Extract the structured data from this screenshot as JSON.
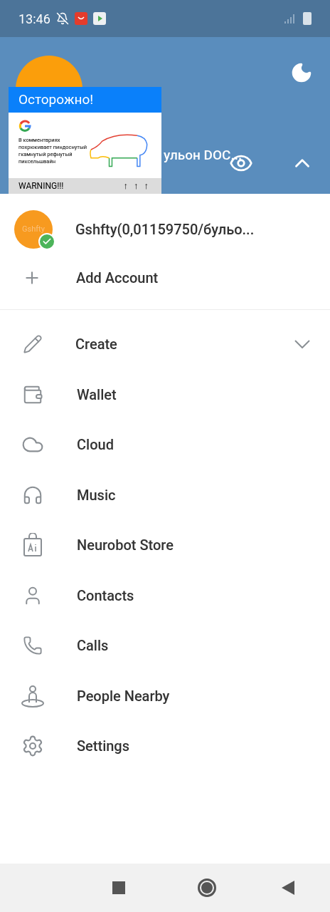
{
  "status_bar": {
    "time": "13:46"
  },
  "header": {
    "account_name": "ульон DOC...",
    "accounts_expanded": true
  },
  "overlay_card": {
    "title": "Осторожно!",
    "body": "В комментвриях похрюкивает пиндоснутый гкамнутый рефнутый пиксельшвайн",
    "footer": "WARNING!!!",
    "arrows": [
      "↑",
      "↑",
      "↑"
    ]
  },
  "accounts": [
    {
      "avatar_text": "Gshfty",
      "name": "Gshfty(0,01159750/бульо...",
      "selected": true
    }
  ],
  "add_account": "Add Account",
  "menu": [
    {
      "label": "Create",
      "kind": "expandable",
      "expanded": false
    },
    {
      "label": "Wallet",
      "kind": "item"
    },
    {
      "label": "Cloud",
      "kind": "item"
    },
    {
      "label": "Music",
      "kind": "item"
    },
    {
      "label": "Neurobot Store",
      "kind": "item"
    },
    {
      "label": "Contacts",
      "kind": "item"
    },
    {
      "label": "Calls",
      "kind": "item"
    },
    {
      "label": "People Nearby",
      "kind": "item"
    },
    {
      "label": "Settings",
      "kind": "item"
    }
  ]
}
